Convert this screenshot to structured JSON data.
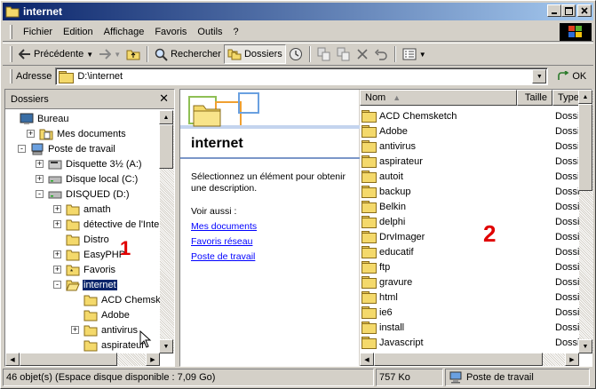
{
  "window": {
    "title": "internet"
  },
  "menu": [
    "Fichier",
    "Edition",
    "Affichage",
    "Favoris",
    "Outils",
    "?"
  ],
  "toolbar": {
    "back_label": "Précédente",
    "search_label": "Rechercher",
    "folders_label": "Dossiers"
  },
  "address": {
    "label": "Adresse",
    "value": "D:\\internet",
    "go_label": "OK"
  },
  "left_panel": {
    "title": "Dossiers",
    "tree": [
      {
        "label": "Bureau",
        "icon": "desktop-icon",
        "expander": ""
      },
      {
        "label": "Mes documents",
        "icon": "documents-folder-icon",
        "expander": "+"
      },
      {
        "label": "Poste de travail",
        "icon": "computer-icon",
        "expander": "-"
      },
      {
        "label": "Disquette 3½ (A:)",
        "icon": "floppy-icon",
        "expander": "+"
      },
      {
        "label": "Disque local (C:)",
        "icon": "drive-icon",
        "expander": "+"
      },
      {
        "label": "DISQUED (D:)",
        "icon": "drive-icon",
        "expander": "-"
      },
      {
        "label": "amath",
        "icon": "folder-icon",
        "expander": "+"
      },
      {
        "label": "détective de l'Intern",
        "icon": "folder-icon",
        "expander": "+"
      },
      {
        "label": "Distro",
        "icon": "folder-icon",
        "expander": ""
      },
      {
        "label": "EasyPHP",
        "icon": "folder-icon",
        "expander": "+"
      },
      {
        "label": "Favoris",
        "icon": "favorites-folder-icon",
        "expander": "+"
      },
      {
        "label": "internet",
        "icon": "open-folder-icon",
        "expander": "-",
        "selected": true
      },
      {
        "label": "ACD Chemsketc",
        "icon": "folder-icon",
        "expander": ""
      },
      {
        "label": "Adobe",
        "icon": "folder-icon",
        "expander": ""
      },
      {
        "label": "antivirus",
        "icon": "folder-icon",
        "expander": "+"
      },
      {
        "label": "aspirateur",
        "icon": "folder-icon",
        "expander": ""
      }
    ]
  },
  "webview": {
    "folder_title": "internet",
    "description": "Sélectionnez un élément pour obtenir une description.",
    "see_also": "Voir aussi :",
    "links": [
      "Mes documents",
      "Favoris réseau",
      "Poste de travail"
    ]
  },
  "list": {
    "columns": [
      "Nom",
      "Taille",
      "Type"
    ],
    "files": [
      {
        "name": "ACD Chemsketch",
        "type": "Dossi"
      },
      {
        "name": "Adobe",
        "type": "Dossi"
      },
      {
        "name": "antivirus",
        "type": "Dossi"
      },
      {
        "name": "aspirateur",
        "type": "Dossi"
      },
      {
        "name": "autoit",
        "type": "Dossi"
      },
      {
        "name": "backup",
        "type": "Dossi"
      },
      {
        "name": "Belkin",
        "type": "Dossi"
      },
      {
        "name": "delphi",
        "type": "Dossi"
      },
      {
        "name": "DrvImager",
        "type": "Dossi"
      },
      {
        "name": "educatif",
        "type": "Dossi"
      },
      {
        "name": "ftp",
        "type": "Dossi"
      },
      {
        "name": "gravure",
        "type": "Dossi"
      },
      {
        "name": "html",
        "type": "Dossi"
      },
      {
        "name": "ie6",
        "type": "Dossi"
      },
      {
        "name": "install",
        "type": "Dossi"
      },
      {
        "name": "Javascript",
        "type": "Dossi"
      }
    ]
  },
  "annotations": [
    "1",
    "2"
  ],
  "status": {
    "objects": "46 objet(s) (Espace disque disponible : 7,09 Go)",
    "size": "757 Ko",
    "zone": "Poste de travail"
  },
  "colors": {
    "titlebar_start": "#0a246a",
    "titlebar_end": "#a6caf0",
    "annotation": "#e00000",
    "link": "#0000ff"
  }
}
